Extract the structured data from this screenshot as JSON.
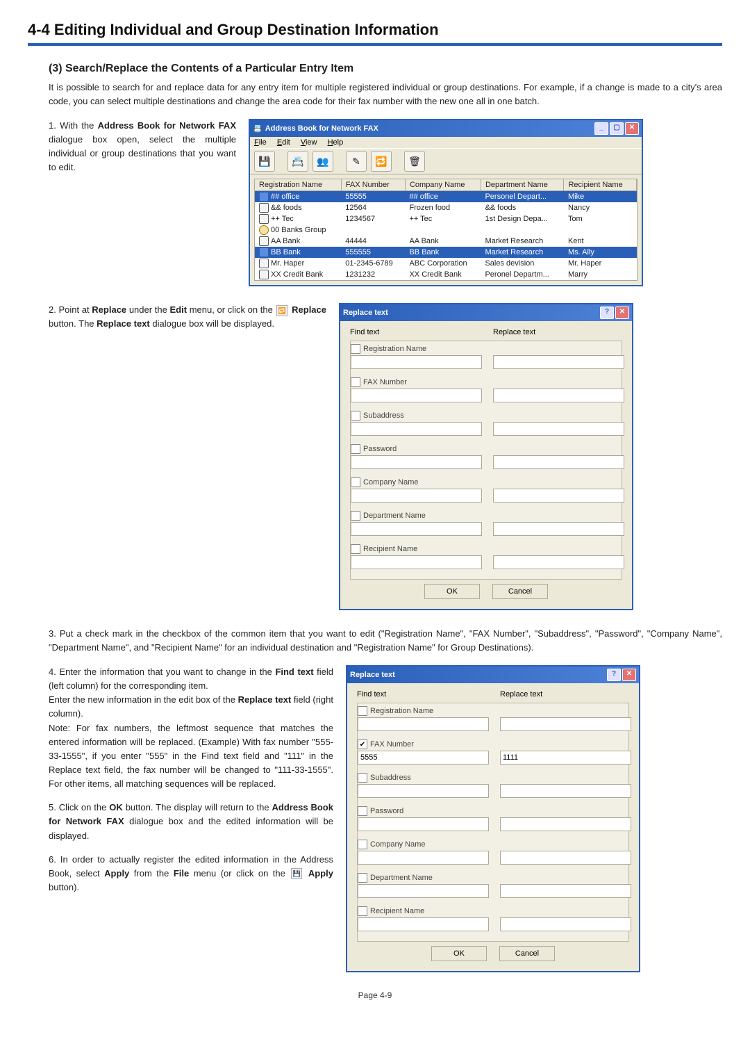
{
  "header": {
    "title": "4-4 Editing Individual and Group Destination Information",
    "sub": "(3) Search/Replace the Contents of a Particular Entry Item",
    "intro": "It is possible to search for and replace data for any entry item for multiple registered individual or group destinations. For example, if a change is made to a city's area code, you can select multiple destinations and change the area code for their fax number with the new one all in one batch."
  },
  "steps": {
    "s1": "1. With the Address Book for Network FAX dialogue box open, select the multiple individual or group destinations that you want to edit.",
    "s2": "2. Point at Replace under the Edit menu, or click on the Replace button. The Replace text dialogue box will be displayed.",
    "s3": "3. Put a check mark in the checkbox of the common item that you want to edit (\"Registration Name\", \"FAX Number\", \"Subaddress\", \"Password\", \"Company Name\", \"Department Name\", and \"Recipient Name\" for an individual destination and \"Registration Name\" for Group Destinations).",
    "s4a": "4. Enter the information that you want to change in the Find text field (left column) for the corresponding item.",
    "s4b": "Enter the new information in the edit box of the Replace text field (right column).",
    "s4c": "Note: For fax numbers, the leftmost sequence that matches the entered information will be replaced. (Example) With fax number \"555-33-1555\", if you enter \"555\" in the Find text field and \"111\" in the Replace text field, the fax number will be changed to \"111-33-1555\". For other items, all matching sequences will be replaced.",
    "s5": "5. Click on the OK button. The display will return to the Address Book for Network FAX dialogue box and the edited information will be displayed.",
    "s6": "6. In order to actually register the edited information in the Address Book, select Apply from the File menu (or click on the Apply button)."
  },
  "addrbook": {
    "title": "Address Book for Network FAX",
    "menus": [
      "File",
      "Edit",
      "View",
      "Help"
    ],
    "columns": [
      "Registration Name",
      "FAX Number",
      "Company Name",
      "Department Name",
      "Recipient Name"
    ],
    "rows": [
      {
        "sel": true,
        "iconType": "bluecard",
        "reg": "## office",
        "fax": "55555",
        "company": "## office",
        "dept": "Personel Depart...",
        "recip": "Mike"
      },
      {
        "sel": false,
        "iconType": "card",
        "reg": "&& foods",
        "fax": "12564",
        "company": "Frozen food",
        "dept": "&& foods",
        "recip": "Nancy"
      },
      {
        "sel": false,
        "iconType": "card",
        "reg": "++ Tec",
        "fax": "1234567",
        "company": "++ Tec",
        "dept": "1st Design Depa...",
        "recip": "Tom"
      },
      {
        "sel": false,
        "iconType": "group",
        "reg": "00 Banks Group",
        "fax": "",
        "company": "",
        "dept": "",
        "recip": ""
      },
      {
        "sel": false,
        "iconType": "card",
        "reg": "AA Bank",
        "fax": "44444",
        "company": "AA Bank",
        "dept": "Market Research",
        "recip": "Kent"
      },
      {
        "sel": true,
        "iconType": "bluecard",
        "reg": "BB Bank",
        "fax": "555555",
        "company": "BB Bank",
        "dept": "Market Research",
        "recip": "Ms. Ally"
      },
      {
        "sel": false,
        "iconType": "card",
        "reg": "Mr. Haper",
        "fax": "01-2345-6789",
        "company": "ABC Corporation",
        "dept": "Sales devision",
        "recip": "Mr. Haper"
      },
      {
        "sel": false,
        "iconType": "card",
        "reg": "XX Credit Bank",
        "fax": "1231232",
        "company": "XX Credit Bank",
        "dept": "Peronel Departm...",
        "recip": "Marry"
      }
    ]
  },
  "dlg": {
    "title": "Replace text",
    "findHeader": "Find text",
    "replaceHeader": "Replace text",
    "labels": {
      "reg": "Registration Name",
      "fax": "FAX Number",
      "sub": "Subaddress",
      "pwd": "Password",
      "company": "Company Name",
      "dept": "Department Name",
      "recip": "Recipient Name"
    },
    "ok": "OK",
    "cancel": "Cancel"
  },
  "dlg2values": {
    "faxFind": "5555",
    "faxReplace": "1111"
  },
  "page": "Page 4-9"
}
